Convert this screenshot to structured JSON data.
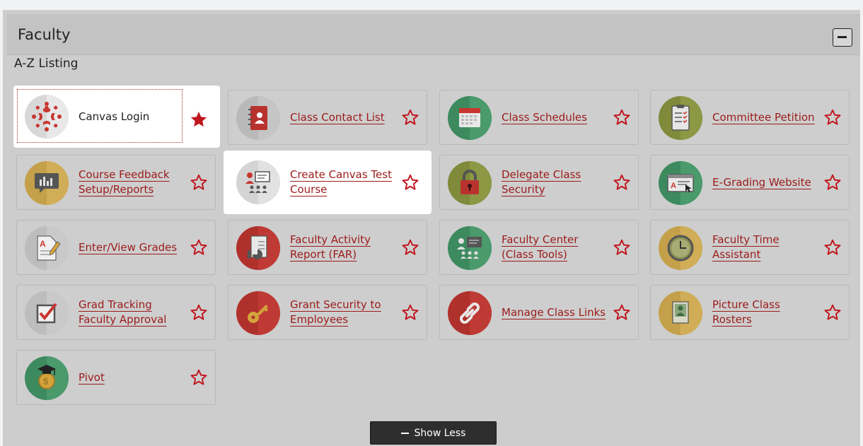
{
  "panel": {
    "title": "Faculty",
    "collapse_icon": "minus-icon"
  },
  "section": {
    "title": "A-Z Listing"
  },
  "tiles": [
    {
      "label": "Canvas Login",
      "icon": "canvas-logo-icon",
      "favorited": true
    },
    {
      "label": "Class Contact List",
      "icon": "address-book-icon",
      "favorited": false
    },
    {
      "label": "Class Schedules",
      "icon": "calendar-icon",
      "favorited": false
    },
    {
      "label": "Committee Petition",
      "icon": "clipboard-icon",
      "favorited": false
    },
    {
      "label": "Course Feedback Setup/Reports",
      "icon": "feedback-chart-icon",
      "favorited": false
    },
    {
      "label": "Create Canvas Test Course",
      "icon": "classroom-icon",
      "favorited": false
    },
    {
      "label": "Delegate Class Security",
      "icon": "lock-icon",
      "favorited": false
    },
    {
      "label": "E-Grading Website",
      "icon": "web-grade-icon",
      "favorited": false
    },
    {
      "label": "Enter/View Grades",
      "icon": "grade-pencil-icon",
      "favorited": false
    },
    {
      "label": "Faculty Activity Report (FAR)",
      "icon": "report-chart-icon",
      "favorited": false
    },
    {
      "label": "Faculty Center (Class Tools)",
      "icon": "classroom-board-icon",
      "favorited": false
    },
    {
      "label": "Faculty Time Assistant",
      "icon": "clock-icon",
      "favorited": false
    },
    {
      "label": "Grad Tracking Faculty Approval",
      "icon": "checkbox-icon",
      "favorited": false
    },
    {
      "label": "Grant Security to Employees",
      "icon": "key-icon",
      "favorited": false
    },
    {
      "label": "Manage Class Links",
      "icon": "link-icon",
      "favorited": false
    },
    {
      "label": "Picture Class Rosters",
      "icon": "photo-roster-icon",
      "favorited": false
    },
    {
      "label": "Pivot",
      "icon": "graduation-coin-icon",
      "favorited": false
    }
  ],
  "show_less": {
    "label": "Show Less"
  },
  "colors": {
    "link": "#9b1b1b",
    "star": "#c0161e",
    "panel_bg": "#cdcdcd",
    "button_bg": "#2e2e2e"
  }
}
